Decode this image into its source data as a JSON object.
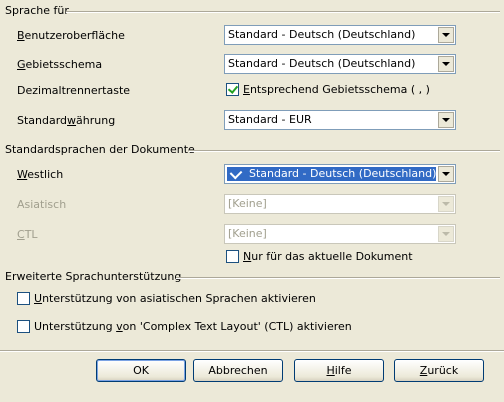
{
  "section_lang_for": {
    "title": "Sprache für",
    "ui_label_u": "B",
    "ui_label_rest": "enutzeroberfläche",
    "ui_value": "Standard - Deutsch (Deutschland)",
    "locale_label_u": "G",
    "locale_label_rest": "ebietsschema",
    "locale_value": "Standard - Deutsch (Deutschland)",
    "decimal_label": "Dezimaltrennertaste",
    "decimal_check_u": "E",
    "decimal_check_rest": "ntsprechend Gebietsschema ( , )",
    "decimal_checked": true,
    "currency_label_pre": "Standard",
    "currency_label_u": "w",
    "currency_label_rest": "ährung",
    "currency_value": "Standard - EUR"
  },
  "section_doc_lang": {
    "title": "Standardsprachen der Dokumente",
    "western_label_u": "W",
    "western_label_rest": "estlich",
    "western_value": "Standard - Deutsch (Deutschland)",
    "asian_label": "Asiatisch",
    "asian_value": "[Keine]",
    "ctl_label_u": "C",
    "ctl_label_rest": "TL",
    "ctl_value": "[Keine]",
    "current_doc_u": "N",
    "current_doc_rest": "ur für das aktuelle Dokument",
    "current_doc_checked": false
  },
  "section_ext": {
    "title": "Erweiterte Sprachunterstützung",
    "asian_support_u": "U",
    "asian_support_rest": "nterstützung von asiatischen Sprachen aktivieren",
    "asian_support_checked": false,
    "ctl_support_pre": "Unterstützung ",
    "ctl_support_u": "v",
    "ctl_support_rest": "on 'Complex Text Layout' (CTL) aktivieren",
    "ctl_support_checked": false
  },
  "buttons": {
    "ok": "OK",
    "cancel": "Abbrechen",
    "help_u": "H",
    "help_rest": "ilfe",
    "back_u": "Z",
    "back_rest": "urück"
  }
}
